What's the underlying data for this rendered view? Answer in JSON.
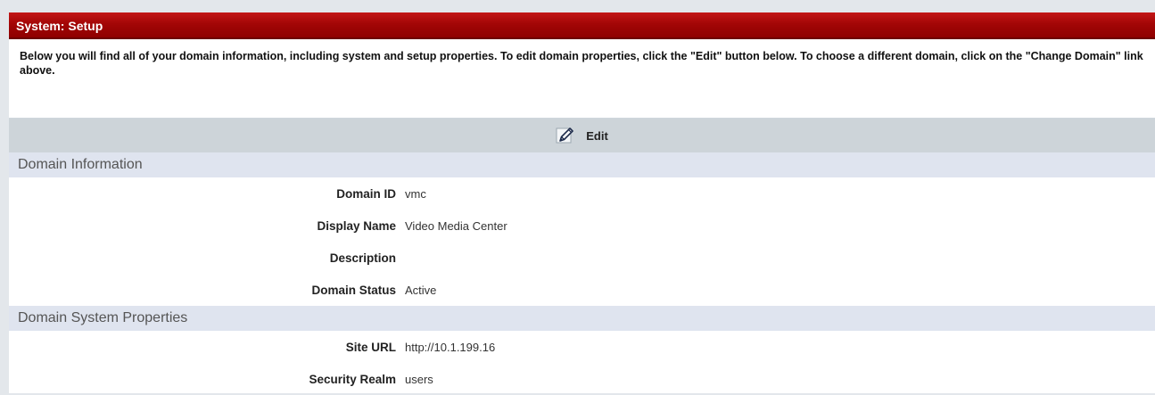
{
  "panel": {
    "title": "System: Setup",
    "intro_text": "Below you will find all of your domain information, including system and setup properties. To edit domain properties, click the \"Edit\" button below. To choose a different domain, click on the \"Change Domain\" link above."
  },
  "toolbar": {
    "edit_label": "Edit",
    "edit_icon": "pencil-icon"
  },
  "domain_information": {
    "heading": "Domain Information",
    "rows": [
      {
        "label": "Domain ID",
        "value": "vmc"
      },
      {
        "label": "Display Name",
        "value": "Video Media Center"
      },
      {
        "label": "Description",
        "value": ""
      },
      {
        "label": "Domain Status",
        "value": "Active"
      }
    ]
  },
  "domain_system_properties": {
    "heading": "Domain System Properties",
    "rows": [
      {
        "label": "Site URL",
        "value": "http://10.1.199.16"
      },
      {
        "label": "Security Realm",
        "value": "users"
      }
    ]
  },
  "colors": {
    "title_bar": "#a30606",
    "toolbar_bg": "#cdd4d9",
    "section_bg": "#dfe4ef",
    "page_bg": "#e3e7eb"
  }
}
